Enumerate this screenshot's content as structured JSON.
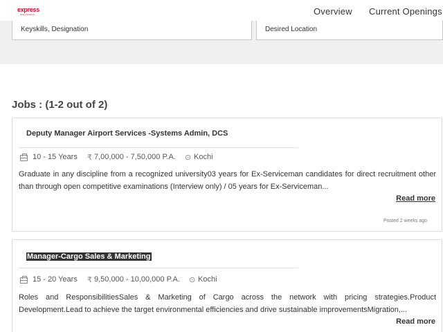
{
  "header": {
    "logo_text": "express",
    "logo_subtext": "Hiring Solutions",
    "nav": [
      "Overview",
      "Current Openings"
    ]
  },
  "search": {
    "keyskills_placeholder": "Keyskills, Designation",
    "location_placeholder": "Desired Location"
  },
  "jobs_heading": "Jobs : (1-2 out of 2)",
  "jobs": [
    {
      "title": "Deputy Manager Airport Services -Systems Admin, DCS",
      "experience": "10 - 15 Years",
      "salary": "7,00,000 - 7,50,000 P.A.",
      "location": "Kochi",
      "description": "Graduate in any discipline from a recognized university03 years for Ex-Serviceman candidates for direct recruitment other than through open competitive examinations (Interview only) / 05 years for Ex-Serviceman...",
      "read_more": "Read more",
      "posted": "Posted 2 weeks ago"
    },
    {
      "title": "Manager-Cargo Sales & Marketing",
      "experience": "15 - 20 Years",
      "salary": "9,50,000 - 10,00,000 P.A.",
      "location": "Kochi",
      "description": "Roles and ResponsibilitiesSales & Marketing of Cargo across the network with pricing strategies.Product Development.Lead to achieve the target environmental efficiencies and drive sustainable improvementsMigration,...",
      "read_more": "Read more"
    }
  ],
  "icons": {
    "experience": "briefcase-icon",
    "salary": "rupee-icon",
    "location": "location-pin-icon"
  },
  "colors": {
    "brand": "#c8102e",
    "band": "#f0f0f0"
  }
}
